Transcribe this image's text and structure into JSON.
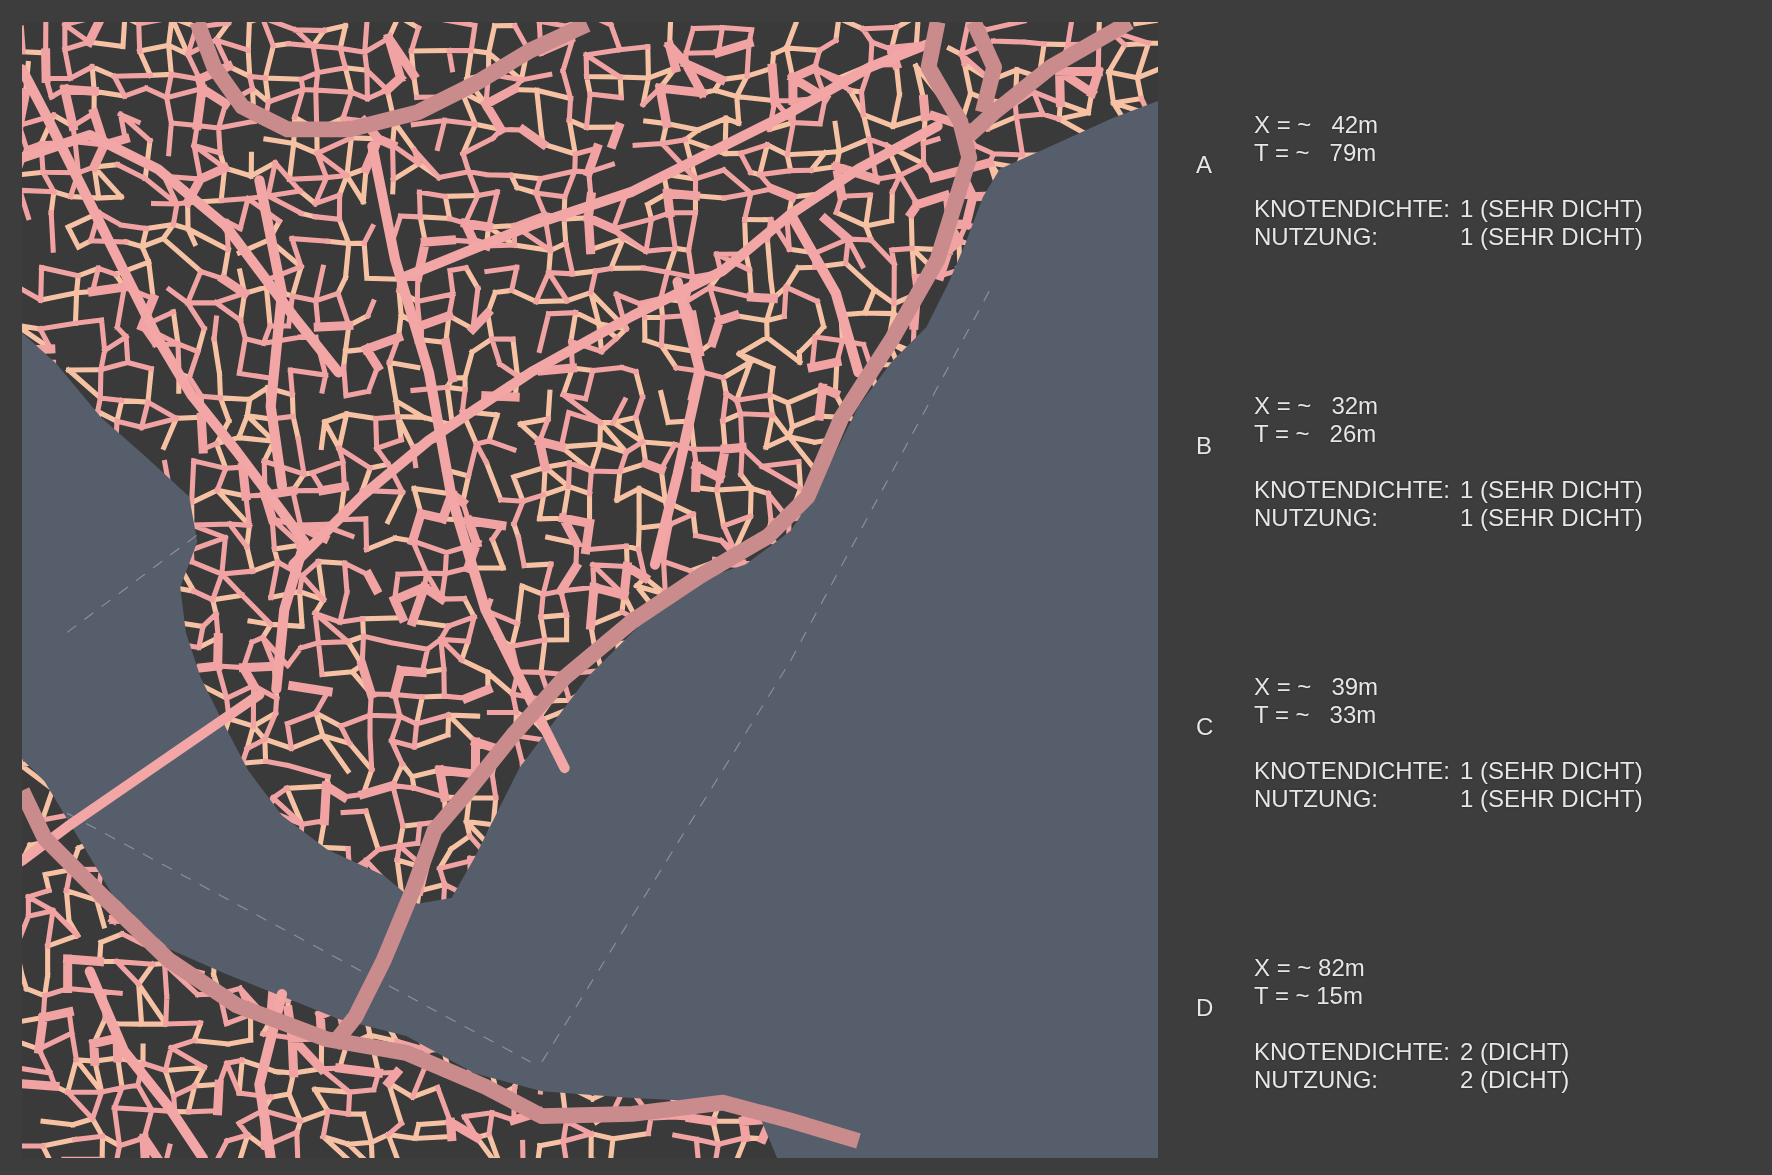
{
  "sections": [
    {
      "letter": "A",
      "measures": [
        "X = ~   42m",
        "T = ~   79m"
      ],
      "ratings": [
        {
          "label": "KNOTENDICHTE:",
          "value": "1 (SEHR DICHT)"
        },
        {
          "label": "NUTZUNG:",
          "value": "1 (SEHR DICHT)"
        }
      ]
    },
    {
      "letter": "B",
      "measures": [
        "X = ~   32m",
        "T = ~   26m"
      ],
      "ratings": [
        {
          "label": "KNOTENDICHTE:",
          "value": "1 (SEHR DICHT)"
        },
        {
          "label": "NUTZUNG:",
          "value": "1 (SEHR DICHT)"
        }
      ]
    },
    {
      "letter": "C",
      "measures": [
        "X = ~   39m",
        "T = ~   33m"
      ],
      "ratings": [
        {
          "label": "KNOTENDICHTE:",
          "value": "1 (SEHR DICHT)"
        },
        {
          "label": "NUTZUNG:",
          "value": "1 (SEHR DICHT)"
        }
      ]
    },
    {
      "letter": "D",
      "measures": [
        "X = ~ 82m",
        "T = ~ 15m"
      ],
      "ratings": [
        {
          "label": "KNOTENDICHTE:",
          "value": "2 (DICHT)"
        },
        {
          "label": "NUTZUNG:",
          "value": "2 (DICHT)"
        }
      ]
    }
  ]
}
